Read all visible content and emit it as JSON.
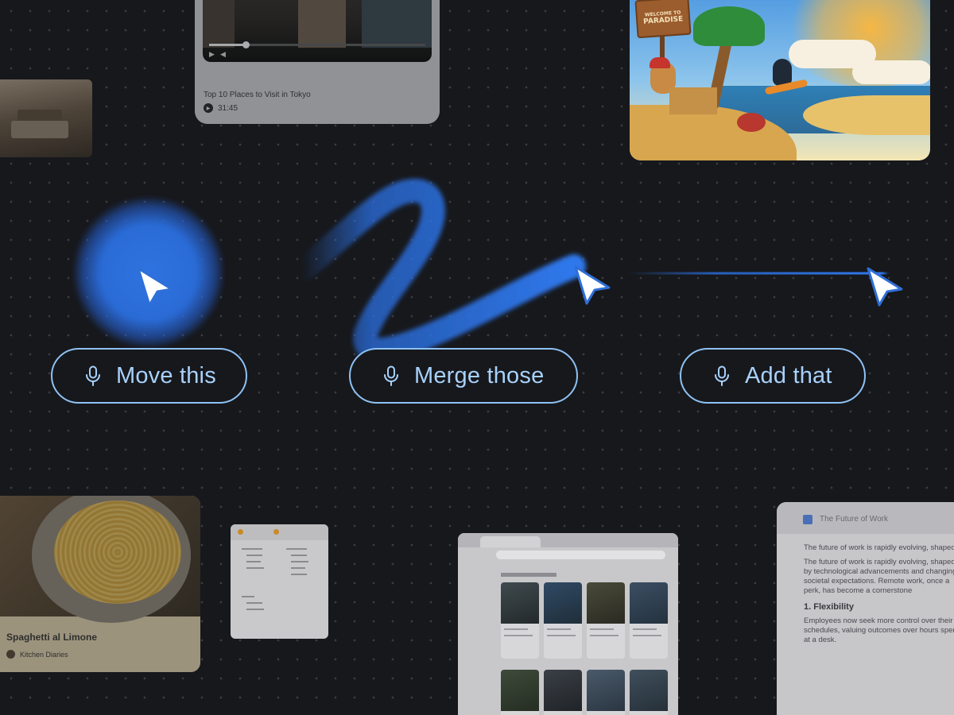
{
  "voice_commands": [
    {
      "label": "Move this"
    },
    {
      "label": "Merge those"
    },
    {
      "label": "Add that"
    }
  ],
  "video_card": {
    "title": "Top 10 Places to Visit in Tokyo",
    "duration": "31:45",
    "progress": 0.17
  },
  "illustration_card": {
    "sign_line1": "WELCOME TO",
    "sign_line2": "PARADISE"
  },
  "recipe_card": {
    "title": "Spaghetti al Limone",
    "source": "Kitchen Diaries"
  },
  "document_card": {
    "title": "The Future of Work",
    "intro_1": "The future of work is rapidly evolving, shaped by technological advancements",
    "intro_2": "The future of work is rapidly evolving, shaped by technological advancements and changing societal expectations. Remote work, once a perk, has become a cornerstone",
    "section_heading": "1. Flexibility",
    "section_body": "Employees now seek more control over their schedules, valuing outcomes over hours spent at a desk."
  },
  "colors": {
    "canvas": "#17181c",
    "accent_blue": "#2f73e0",
    "pill_border": "#8ec2f4",
    "pill_text": "#a8d1fb"
  },
  "icons": {
    "pill_icon": "microphone-icon",
    "cursor_icon": "pointer-arrow-icon"
  }
}
